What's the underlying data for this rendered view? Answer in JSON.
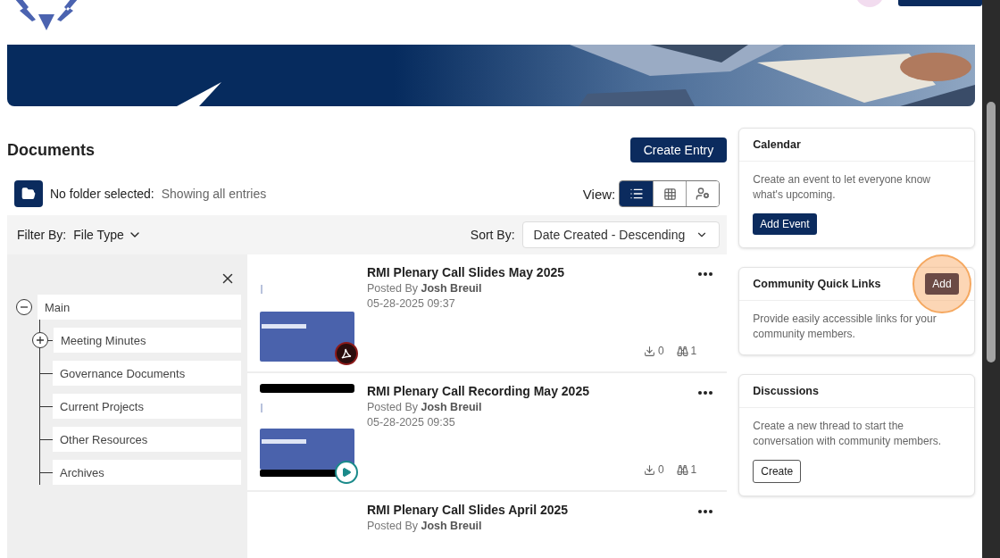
{
  "documents": {
    "title": "Documents",
    "create_button": "Create Entry",
    "folder_label": "No folder selected:",
    "folder_hint": "Showing all entries",
    "view_label": "View:",
    "views": [
      {
        "kind": "list",
        "selected": true
      },
      {
        "kind": "grid",
        "selected": false
      },
      {
        "kind": "people",
        "selected": false
      }
    ],
    "filter_label": "Filter By:",
    "filter_value": "File Type",
    "sort_label": "Sort By:",
    "sort_value": "Date Created - Descending",
    "tree": [
      {
        "label": "Main",
        "expanded": true,
        "children": [
          {
            "label": "Meeting Minutes",
            "expanded": false
          },
          {
            "label": "Governance Documents"
          },
          {
            "label": "Current Projects"
          },
          {
            "label": "Other Resources"
          },
          {
            "label": "Archives"
          }
        ]
      }
    ],
    "entries": [
      {
        "title": "RMI Plenary Call Slides May 2025",
        "posted_by": "Posted By",
        "author": "Josh Breuil",
        "date": "05-28-2025 09:37",
        "kind": "pdf",
        "downloads": "0",
        "views": "1"
      },
      {
        "title": "RMI Plenary Call Recording May 2025",
        "posted_by": "Posted By",
        "author": "Josh Breuil",
        "date": "05-28-2025 09:35",
        "kind": "video",
        "downloads": "0",
        "views": "1"
      },
      {
        "title": "RMI Plenary Call Slides April 2025",
        "posted_by": "Posted By",
        "author": "Josh Breuil",
        "kind": "none"
      }
    ]
  },
  "sidebar": [
    {
      "title": "Calendar",
      "text": "Create an event to let everyone know what's upcoming.",
      "kind": "body",
      "button": {
        "label": "Add Event",
        "kind": "primary"
      }
    },
    {
      "title": "Community Quick Links",
      "text": "Provide easily accessible links for your community members.",
      "kind": "header",
      "button": {
        "label": "Add",
        "kind": "dark",
        "highlighted": true
      }
    },
    {
      "title": "Discussions",
      "text": "Create a new thread to start the conversation with community members.",
      "kind": "body",
      "button": {
        "label": "Create",
        "kind": "outline"
      }
    }
  ]
}
